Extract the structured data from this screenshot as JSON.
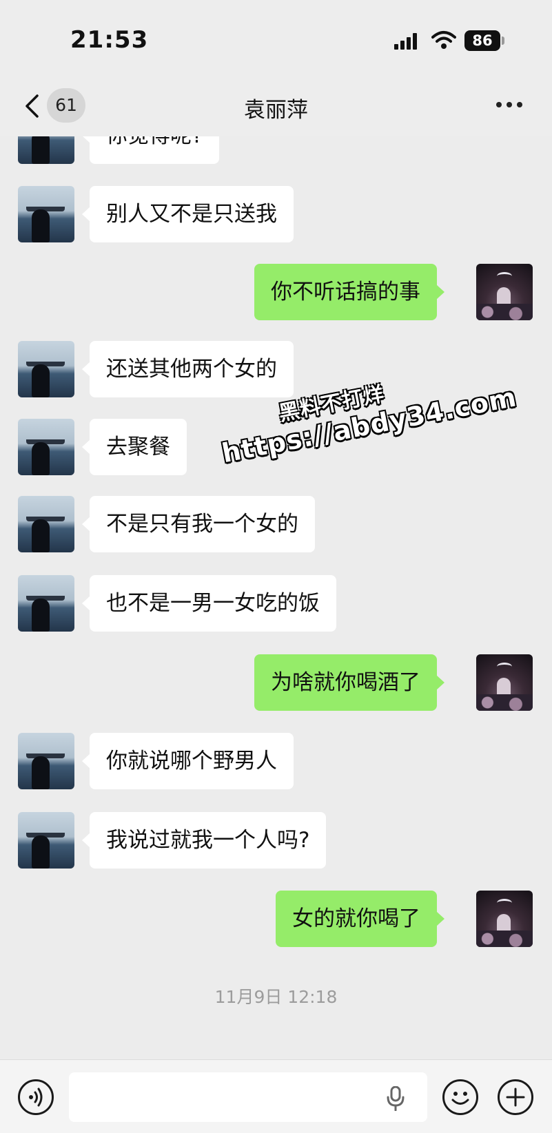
{
  "status_bar": {
    "time": "21:53",
    "battery": "86"
  },
  "nav": {
    "unread_count": "61",
    "title": "袁丽萍",
    "icons": [
      "chevron-left-icon",
      "more-icon"
    ]
  },
  "messages": [
    {
      "sender": "other",
      "text": "你觉得呢?"
    },
    {
      "sender": "other",
      "text": "别人又不是只送我"
    },
    {
      "sender": "self",
      "text": "你不听话搞的事"
    },
    {
      "sender": "other",
      "text": "还送其他两个女的"
    },
    {
      "sender": "other",
      "text": "去聚餐"
    },
    {
      "sender": "other",
      "text": "不是只有我一个女的"
    },
    {
      "sender": "other",
      "text": "也不是一男一女吃的饭"
    },
    {
      "sender": "self",
      "text": "为啥就你喝酒了"
    },
    {
      "sender": "other",
      "text": "你就说哪个野男人"
    },
    {
      "sender": "other",
      "text": "我说过就我一个人吗?"
    },
    {
      "sender": "self",
      "text": "女的就你喝了"
    }
  ],
  "timestamp": "11月9日 12:18",
  "watermark": {
    "line1": "黑料不打烊",
    "line2": "https://abdy34.com"
  },
  "input_bar": {
    "icons": [
      "voice-icon",
      "microphone-icon",
      "emoji-icon",
      "plus-icon"
    ]
  },
  "colors": {
    "self_bubble": "#95ec69",
    "other_bubble": "#ffffff",
    "background": "#ececec"
  }
}
